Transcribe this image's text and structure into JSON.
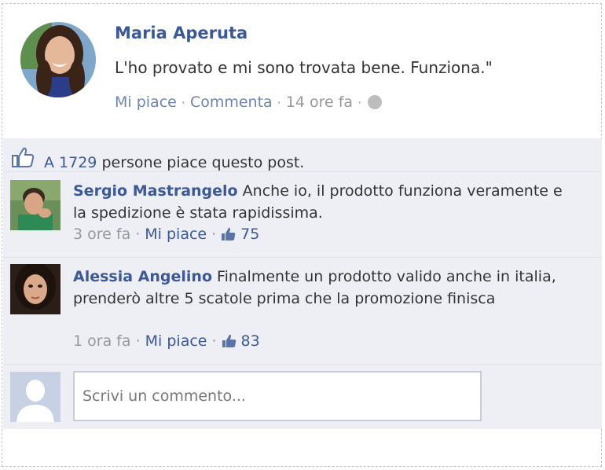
{
  "post": {
    "author": "Maria Aperuta",
    "text": "L'ho provato e mi sono trovata bene. Funziona.\"",
    "like_label": "Mi piace",
    "comment_label": "Commenta",
    "time": "14 ore fa",
    "separator": "·"
  },
  "likes": {
    "prefix": "A",
    "count": "1729",
    "suffix": "persone piace questo post."
  },
  "comments": [
    {
      "author": "Sergio Mastrangelo",
      "text": "Anche io, il prodotto funziona veramente e la spedizione è stata rapidissima.",
      "time": "3 ore fa",
      "like_label": "Mi piace",
      "likes": "75"
    },
    {
      "author": "Alessia Angelino",
      "text": "Finalmente un prodotto valido anche in italia, prenderò altre 5 scatole prima che la promozione finisca",
      "time": "1 ora fa",
      "like_label": "Mi piace",
      "likes": "83"
    }
  ],
  "compose": {
    "placeholder": "Scrivi un commento..."
  },
  "colors": {
    "link": "#3b5998",
    "feed_bg": "#edeff4"
  },
  "icons": [
    "globe-icon",
    "thumbs-up-icon",
    "default-avatar-icon"
  ]
}
